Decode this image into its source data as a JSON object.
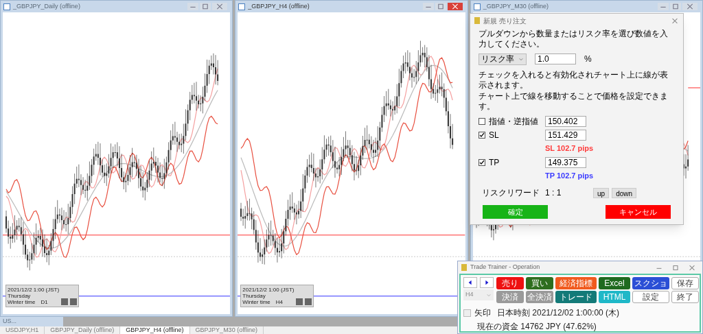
{
  "chart_windows": [
    {
      "title": "_GBPJPY_Daily (offline)",
      "active": false,
      "info": {
        "time": "2021/12/2 1:00 (JST)",
        "day": "Thursday",
        "season": "Winter time",
        "timeframe": "D1"
      }
    },
    {
      "title": "_GBPJPY_H4 (offline)",
      "active": true,
      "info": {
        "time": "2021/12/2 1:00 (JST)",
        "day": "Thursday",
        "season": "Winter time",
        "timeframe": "H4"
      }
    },
    {
      "title": "_GBPJPY_M30 (offline)",
      "active": false
    }
  ],
  "order_dialog": {
    "title": "新規 売り注文",
    "instruction": "プルダウンから数量またはリスク率を選び数値を入力してください。",
    "mode": "リスク率",
    "risk_value": "1.0",
    "unit": "%",
    "notes": [
      "チェックを入れると有効化されチャート上に線が表示されます。",
      "チャート上で線を移動することで価格を設定できます。"
    ],
    "rows": [
      {
        "label": "指値・逆指値",
        "checked": false,
        "value": "150.402"
      },
      {
        "label": "SL",
        "checked": true,
        "value": "151.429",
        "pips": "SL 102.7 pips",
        "color": "#ff3b3b"
      },
      {
        "label": "TP",
        "checked": true,
        "value": "149.375",
        "pips": "TP 102.7 pips",
        "color": "#3b3bff"
      }
    ],
    "risk_reward_label": "リスクリワード",
    "risk_reward": "1 : 1",
    "step_buttons": [
      "up",
      "down"
    ],
    "confirm": "確定",
    "cancel": "キャンセル"
  },
  "operation": {
    "title": "Trade Trainer - Operation",
    "timeframe": "H4",
    "buttons": [
      {
        "label": "売り",
        "color": "#ee1111"
      },
      {
        "label": "買い",
        "color": "#2e6e1e"
      },
      {
        "label": "経済指標",
        "color": "#f05a1e"
      },
      {
        "label": "Excel",
        "color": "#1f6a1f"
      },
      {
        "label": "スクショ",
        "color": "#2b4fd6"
      },
      {
        "label": "保存",
        "color": "#ffffff"
      },
      {
        "label": "決済",
        "color": "#9a9a9a"
      },
      {
        "label": "全決済",
        "color": "#9a9a9a"
      },
      {
        "label": "トレード",
        "color": "#137a78"
      },
      {
        "label": "HTML",
        "color": "#1fb8c8"
      },
      {
        "label": "設定",
        "color": "#ffffff"
      },
      {
        "label": "終了",
        "color": "#ffffff"
      }
    ],
    "arrow_checkbox": {
      "label": "矢印",
      "checked": false
    },
    "japan_time": "日本時刻 2021/12/02 1:00:00 (木)",
    "funds": "現在の資金 14762 JPY (47.62%)"
  },
  "minimized_window": {
    "title": "US..."
  },
  "tabs": [
    {
      "label": "USDJPY,H1",
      "selected": false
    },
    {
      "label": "GBPJPY_Daily (offline)",
      "selected": false
    },
    {
      "label": "GBPJPY_H4 (offline)",
      "selected": true
    },
    {
      "label": "GBPJPY_M30 (offline)",
      "selected": false
    }
  ]
}
